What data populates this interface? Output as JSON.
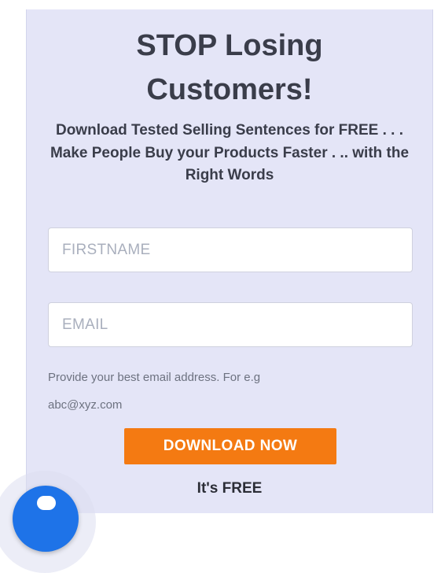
{
  "optin": {
    "headline_line1": "STOP Losing",
    "headline_line2": "Customers!",
    "subheadline": "Download Tested Selling Sentences for FREE . . . Make People Buy your Products Faster . .. with the Right Words",
    "firstname": {
      "placeholder": "FIRSTNAME",
      "value": ""
    },
    "email": {
      "placeholder": "EMAIL",
      "value": ""
    },
    "hint_line1": "Provide your best email address. For e.g",
    "hint_line2": "abc@xyz.com",
    "button_label": "DOWNLOAD NOW",
    "free_note": "It's FREE"
  },
  "chat_widget": {
    "icon": "chat-icon"
  },
  "colors": {
    "panel_bg": "#e4e5f7",
    "text": "#3a3d4a",
    "button": "#f47a12",
    "chat": "#1e73e8"
  }
}
